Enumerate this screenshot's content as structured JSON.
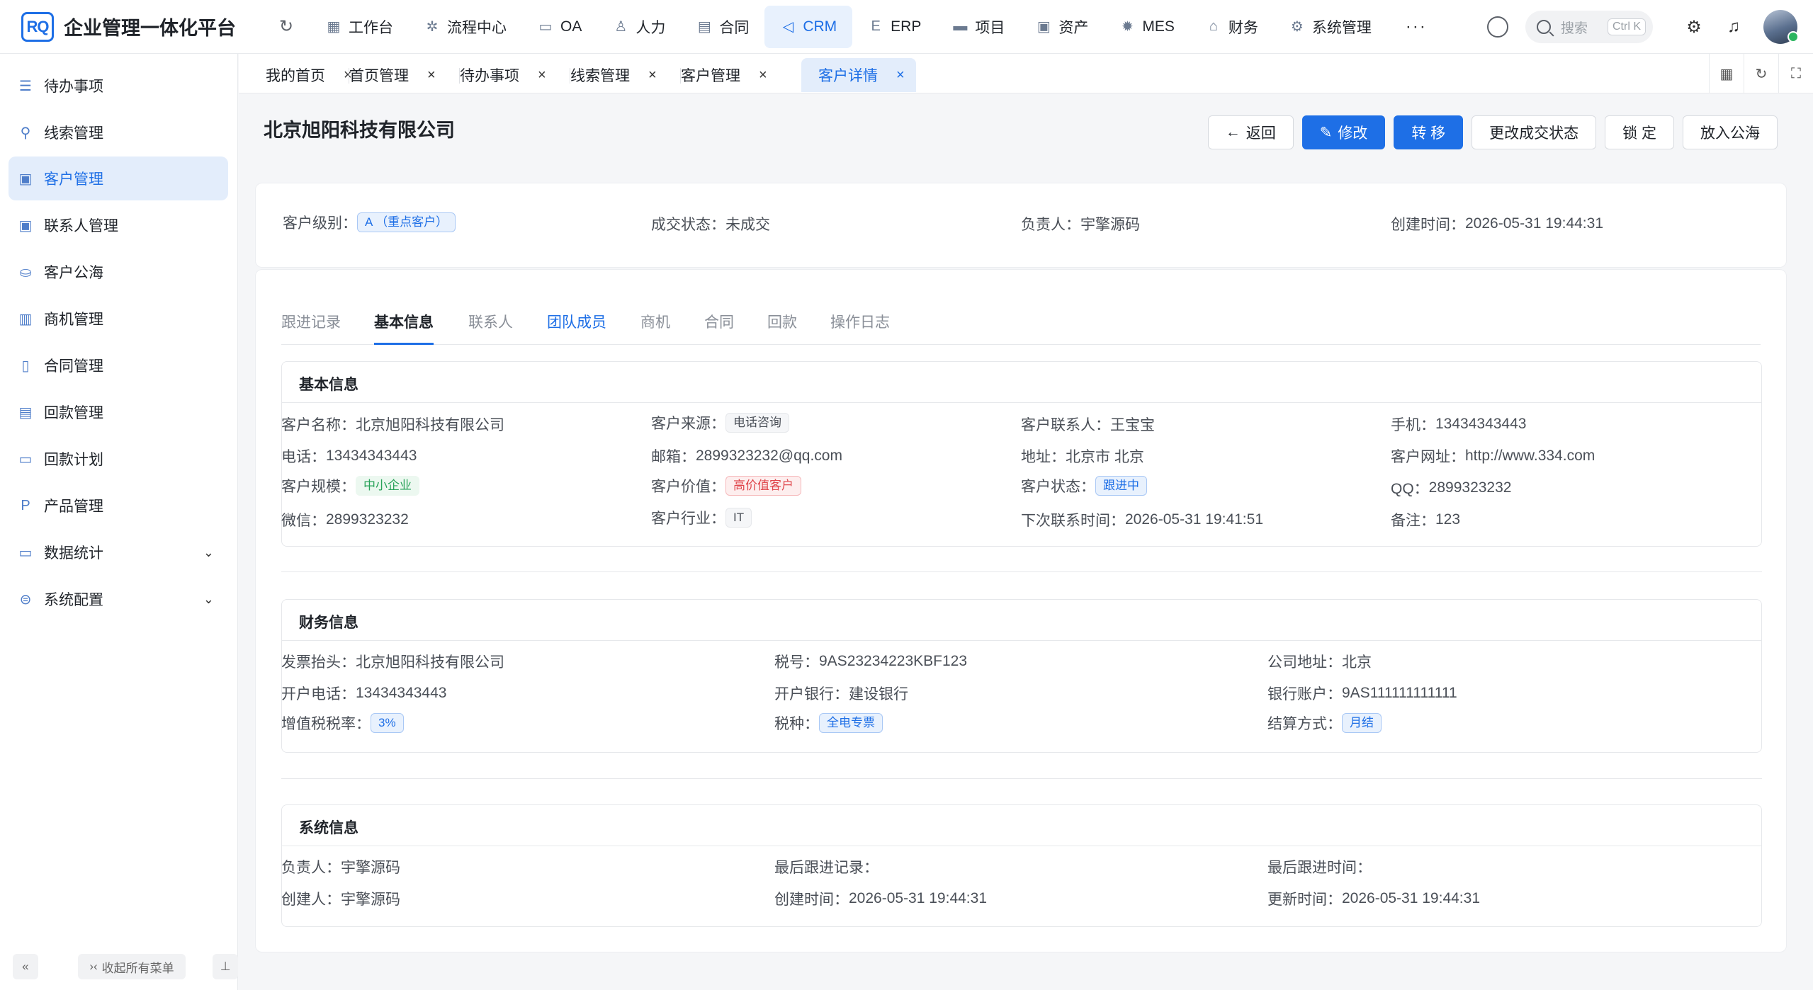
{
  "app": {
    "logo": "RQ",
    "title": "企业管理一体化平台"
  },
  "topnav": [
    {
      "label": "工作台",
      "icon": "grid-icon",
      "glyph": "▦"
    },
    {
      "label": "流程中心",
      "icon": "flow-icon",
      "glyph": "✲"
    },
    {
      "label": "OA",
      "icon": "monitor-icon",
      "glyph": "▭"
    },
    {
      "label": "人力",
      "icon": "user-icon",
      "glyph": "♙"
    },
    {
      "label": "合同",
      "icon": "contract-icon",
      "glyph": "▤"
    },
    {
      "label": "CRM",
      "icon": "crm-icon",
      "glyph": "◁"
    },
    {
      "label": "ERP",
      "icon": "erp-icon",
      "glyph": "E"
    },
    {
      "label": "项目",
      "icon": "project-icon",
      "glyph": "▬"
    },
    {
      "label": "资产",
      "icon": "asset-icon",
      "glyph": "▣"
    },
    {
      "label": "MES",
      "icon": "mes-icon",
      "glyph": "✹"
    },
    {
      "label": "财务",
      "icon": "bank-icon",
      "glyph": "⌂"
    },
    {
      "label": "系统管理",
      "icon": "gear-icon",
      "glyph": "⚙"
    }
  ],
  "search": {
    "placeholder": "搜索",
    "shortcut": "Ctrl K"
  },
  "sidebar": {
    "items": [
      {
        "label": "待办事项",
        "icon": "todo-list-icon",
        "glyph": "☰"
      },
      {
        "label": "线索管理",
        "icon": "lead-icon",
        "glyph": "⚲"
      },
      {
        "label": "客户管理",
        "icon": "customer-icon",
        "glyph": "▣"
      },
      {
        "label": "联系人管理",
        "icon": "contact-icon",
        "glyph": "▣"
      },
      {
        "label": "客户公海",
        "icon": "sea-icon",
        "glyph": "⛀"
      },
      {
        "label": "商机管理",
        "icon": "bus-icon",
        "glyph": "▥"
      },
      {
        "label": "合同管理",
        "icon": "contract-icon",
        "glyph": "▯"
      },
      {
        "label": "回款管理",
        "icon": "payment-icon",
        "glyph": "▤"
      },
      {
        "label": "回款计划",
        "icon": "plan-icon",
        "glyph": "▭"
      },
      {
        "label": "产品管理",
        "icon": "product-icon",
        "glyph": "P"
      },
      {
        "label": "数据统计",
        "icon": "stats-icon",
        "glyph": "▭",
        "expand": "⌄"
      },
      {
        "label": "系统配置",
        "icon": "config-icon",
        "glyph": "⊜",
        "expand": "⌄"
      }
    ],
    "collapse_all": "收起所有菜单"
  },
  "tabs": [
    {
      "label": "我的首页"
    },
    {
      "label": "首页管理"
    },
    {
      "label": "待办事项"
    },
    {
      "label": "线索管理"
    },
    {
      "label": "客户管理"
    },
    {
      "label": "客户详情"
    }
  ],
  "page": {
    "title": "北京旭阳科技有限公司",
    "buttons": {
      "back": "返回",
      "edit": "修改",
      "transfer": "转 移",
      "change_status": "更改成交状态",
      "lock": "锁 定",
      "to_pool": "放入公海"
    }
  },
  "summary": {
    "level_label": "客户级别：",
    "level_value": "A （重点客户）",
    "deal_label": "成交状态：",
    "deal_value": "未成交",
    "owner_label": "负责人：",
    "owner_value": "宇擎源码",
    "created_label": "创建时间：",
    "created_value": "2026-05-31 19:44:31"
  },
  "detail_tabs": [
    "跟进记录",
    "基本信息",
    "联系人",
    "团队成员",
    "商机",
    "合同",
    "回款",
    "操作日志"
  ],
  "basic": {
    "title": "基本信息",
    "name_l": "客户名称：",
    "name_v": "北京旭阳科技有限公司",
    "source_l": "客户来源：",
    "source_v": "电话咨询",
    "contact_l": "客户联系人：",
    "contact_v": "王宝宝",
    "mobile_l": "手机：",
    "mobile_v": "13434343443",
    "phone_l": "电话：",
    "phone_v": "13434343443",
    "email_l": "邮箱：",
    "email_v": "2899323232@qq.com",
    "addr_l": "地址：",
    "addr_v": "北京市 北京",
    "site_l": "客户网址：",
    "site_v": "http://www.334.com",
    "scale_l": "客户规模：",
    "scale_v": "中小企业",
    "value_l": "客户价值：",
    "value_v": "高价值客户",
    "status_l": "客户状态：",
    "status_v": "跟进中",
    "qq_l": "QQ：",
    "qq_v": "2899323232",
    "wechat_l": "微信：",
    "wechat_v": "2899323232",
    "industry_l": "客户行业：",
    "industry_v": "IT",
    "next_l": "下次联系时间：",
    "next_v": "2026-05-31 19:41:51",
    "remark_l": "备注：",
    "remark_v": "123"
  },
  "finance": {
    "title": "财务信息",
    "invoice_l": "发票抬头：",
    "invoice_v": "北京旭阳科技有限公司",
    "tax_l": "税号：",
    "tax_v": "9AS23234223KBF123",
    "caddr_l": "公司地址：",
    "caddr_v": "北京",
    "bphone_l": "开户电话：",
    "bphone_v": "13434343443",
    "bank_l": "开户银行：",
    "bank_v": "建设银行",
    "acct_l": "银行账户：",
    "acct_v": "9AS111111111111",
    "vat_l": "增值税税率：",
    "vat_v": "3%",
    "taxtype_l": "税种：",
    "taxtype_v": "全电专票",
    "settle_l": "结算方式：",
    "settle_v": "月结"
  },
  "system": {
    "title": "系统信息",
    "owner_l": "负责人：",
    "owner_v": "宇擎源码",
    "lastrec_l": "最后跟进记录：",
    "lastrec_v": "",
    "lasttime_l": "最后跟进时间：",
    "lasttime_v": "",
    "creator_l": "创建人：",
    "creator_v": "宇擎源码",
    "created_l": "创建时间：",
    "created_v": "2026-05-31 19:44:31",
    "updated_l": "更新时间：",
    "updated_v": "2026-05-31 19:44:31"
  },
  "colors": {
    "primary": "#1e6fe6",
    "active_bg": "#e3edfb"
  }
}
